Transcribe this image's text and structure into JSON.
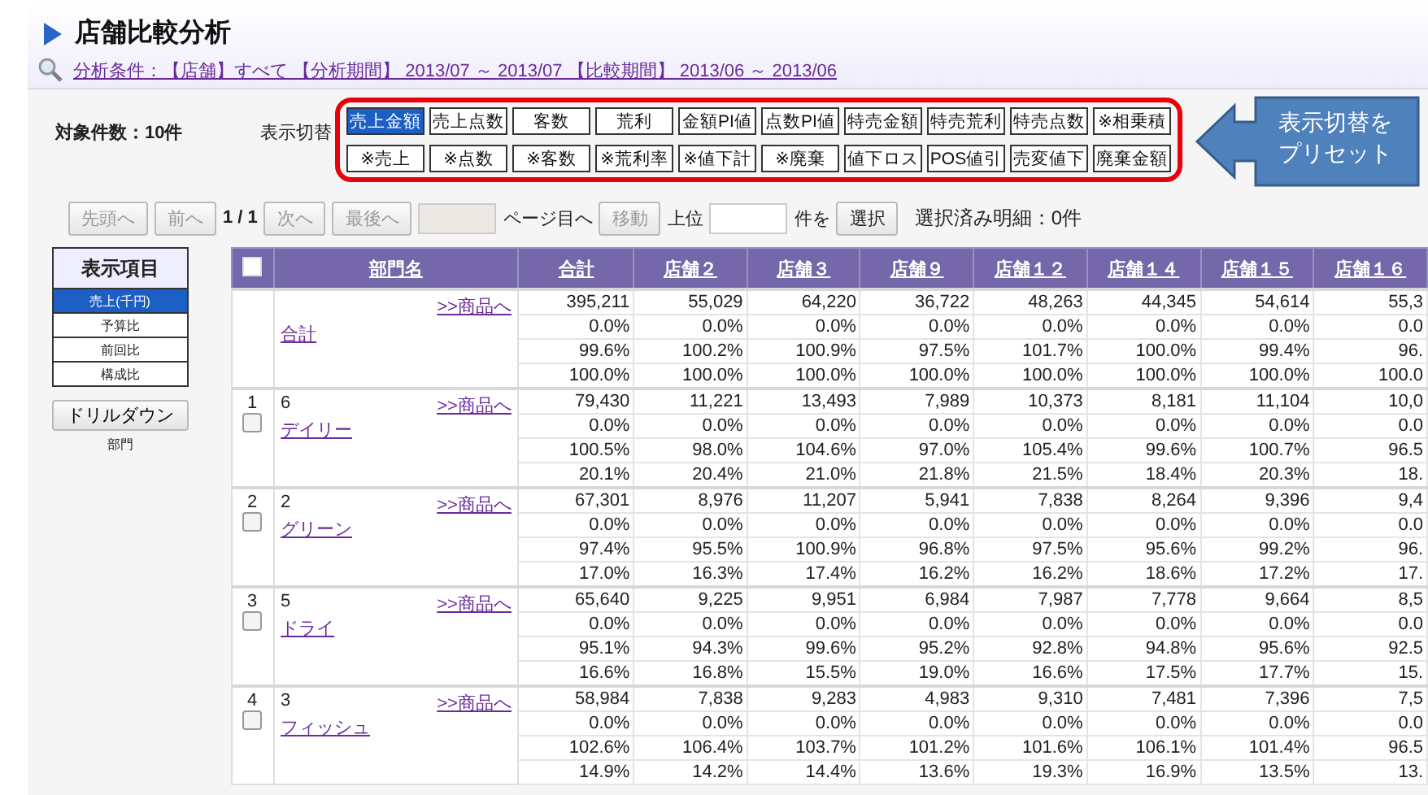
{
  "header": {
    "title": "店舗比較分析",
    "condition": "分析条件：【店舗】すべて 【分析期間】 2013/07 ～ 2013/07 【比較期間】 2013/06 ～ 2013/06"
  },
  "count_label": "対象件数：10件",
  "switch_label": "表示切替",
  "metric_rows": [
    {
      "buttons": [
        {
          "label": "売上金額",
          "selected": true
        },
        {
          "label": "売上点数",
          "selected": false
        },
        {
          "label": "客数",
          "selected": false
        },
        {
          "label": "荒利",
          "selected": false
        },
        {
          "label": "金額PI値",
          "selected": false
        },
        {
          "label": "点数PI値",
          "selected": false
        },
        {
          "label": "特売金額",
          "selected": false
        },
        {
          "label": "特売荒利",
          "selected": false
        },
        {
          "label": "特売点数",
          "selected": false
        },
        {
          "label": "※相乗積",
          "selected": false
        }
      ]
    },
    {
      "buttons": [
        {
          "label": "※売上",
          "selected": false
        },
        {
          "label": "※点数",
          "selected": false
        },
        {
          "label": "※客数",
          "selected": false
        },
        {
          "label": "※荒利率",
          "selected": false
        },
        {
          "label": "※値下計",
          "selected": false
        },
        {
          "label": "※廃棄",
          "selected": false
        },
        {
          "label": "値下ロス",
          "selected": false
        },
        {
          "label": "POS値引",
          "selected": false
        },
        {
          "label": "売変値下",
          "selected": false
        },
        {
          "label": "廃棄金額",
          "selected": false
        }
      ]
    }
  ],
  "callout": {
    "lines": [
      "表示切替を",
      "プリセット"
    ]
  },
  "pager": [
    {
      "kind": "button",
      "label": "先頭へ",
      "disabled": true
    },
    {
      "kind": "button",
      "label": "前へ",
      "disabled": true
    },
    {
      "kind": "text",
      "label": "1 / 1"
    },
    {
      "kind": "button",
      "label": "次へ",
      "disabled": true
    },
    {
      "kind": "button",
      "label": "最後へ",
      "disabled": true
    },
    {
      "kind": "input",
      "disabled": true
    },
    {
      "kind": "text",
      "label": "ページ目へ"
    },
    {
      "kind": "button",
      "label": "移動",
      "disabled": true
    },
    {
      "kind": "text",
      "label": "上位"
    },
    {
      "kind": "input",
      "disabled": false
    },
    {
      "kind": "text",
      "label": "件を"
    },
    {
      "kind": "button",
      "label": "選択",
      "disabled": false
    },
    {
      "kind": "status",
      "label": "選択済み明細：0件"
    }
  ],
  "display_items": {
    "title": "表示項目",
    "items": [
      {
        "label": "売上(千円)",
        "selected": true
      },
      {
        "label": "予算比",
        "selected": false
      },
      {
        "label": "前回比",
        "selected": false
      },
      {
        "label": "構成比",
        "selected": false
      }
    ]
  },
  "drilldown": {
    "button": "ドリルダウン",
    "caption": "部門"
  },
  "table": {
    "header_checkbox": {
      "checked": false
    },
    "columns": [
      "部門名",
      "合計",
      "店舗２",
      "店舗３",
      "店舗９",
      "店舗１２",
      "店舗１４",
      "店舗１５",
      "店舗１６"
    ],
    "groups": [
      {
        "name": "合計",
        "link": ">>商品へ",
        "rows": [
          [
            "395,211",
            "55,029",
            "64,220",
            "36,722",
            "48,263",
            "44,345",
            "54,614",
            "55,3"
          ],
          [
            "0.0%",
            "0.0%",
            "0.0%",
            "0.0%",
            "0.0%",
            "0.0%",
            "0.0%",
            "0.0"
          ],
          [
            "99.6%",
            "100.2%",
            "100.9%",
            "97.5%",
            "101.7%",
            "100.0%",
            "99.4%",
            "96."
          ],
          [
            "100.0%",
            "100.0%",
            "100.0%",
            "100.0%",
            "100.0%",
            "100.0%",
            "100.0%",
            "100.0"
          ]
        ]
      },
      {
        "index": "1",
        "code": "6",
        "name": "デイリー",
        "link": ">>商品へ",
        "checked": false,
        "rows": [
          [
            "79,430",
            "11,221",
            "13,493",
            "7,989",
            "10,373",
            "8,181",
            "11,104",
            "10,0"
          ],
          [
            "0.0%",
            "0.0%",
            "0.0%",
            "0.0%",
            "0.0%",
            "0.0%",
            "0.0%",
            "0.0"
          ],
          [
            "100.5%",
            "98.0%",
            "104.6%",
            "97.0%",
            "105.4%",
            "99.6%",
            "100.7%",
            "96.5"
          ],
          [
            "20.1%",
            "20.4%",
            "21.0%",
            "21.8%",
            "21.5%",
            "18.4%",
            "20.3%",
            "18."
          ]
        ]
      },
      {
        "index": "2",
        "code": "2",
        "name": "グリーン",
        "link": ">>商品へ",
        "checked": false,
        "rows": [
          [
            "67,301",
            "8,976",
            "11,207",
            "5,941",
            "7,838",
            "8,264",
            "9,396",
            "9,4"
          ],
          [
            "0.0%",
            "0.0%",
            "0.0%",
            "0.0%",
            "0.0%",
            "0.0%",
            "0.0%",
            "0.0"
          ],
          [
            "97.4%",
            "95.5%",
            "100.9%",
            "96.8%",
            "97.5%",
            "95.6%",
            "99.2%",
            "96."
          ],
          [
            "17.0%",
            "16.3%",
            "17.4%",
            "16.2%",
            "16.2%",
            "18.6%",
            "17.2%",
            "17."
          ]
        ]
      },
      {
        "index": "3",
        "code": "5",
        "name": "ドライ",
        "link": ">>商品へ",
        "checked": false,
        "rows": [
          [
            "65,640",
            "9,225",
            "9,951",
            "6,984",
            "7,987",
            "7,778",
            "9,664",
            "8,5"
          ],
          [
            "0.0%",
            "0.0%",
            "0.0%",
            "0.0%",
            "0.0%",
            "0.0%",
            "0.0%",
            "0.0"
          ],
          [
            "95.1%",
            "94.3%",
            "99.6%",
            "95.2%",
            "92.8%",
            "94.8%",
            "95.6%",
            "92.5"
          ],
          [
            "16.6%",
            "16.8%",
            "15.5%",
            "19.0%",
            "16.6%",
            "17.5%",
            "17.7%",
            "15."
          ]
        ]
      },
      {
        "index": "4",
        "code": "3",
        "name": "フィッシュ",
        "link": ">>商品へ",
        "checked": false,
        "rows": [
          [
            "58,984",
            "7,838",
            "9,283",
            "4,983",
            "9,310",
            "7,481",
            "7,396",
            "7,5"
          ],
          [
            "0.0%",
            "0.0%",
            "0.0%",
            "0.0%",
            "0.0%",
            "0.0%",
            "0.0%",
            "0.0"
          ],
          [
            "102.6%",
            "106.4%",
            "103.7%",
            "101.2%",
            "101.6%",
            "106.1%",
            "101.4%",
            "96.5"
          ],
          [
            "14.9%",
            "14.2%",
            "14.4%",
            "13.6%",
            "19.3%",
            "16.9%",
            "13.5%",
            "13."
          ]
        ]
      }
    ]
  }
}
